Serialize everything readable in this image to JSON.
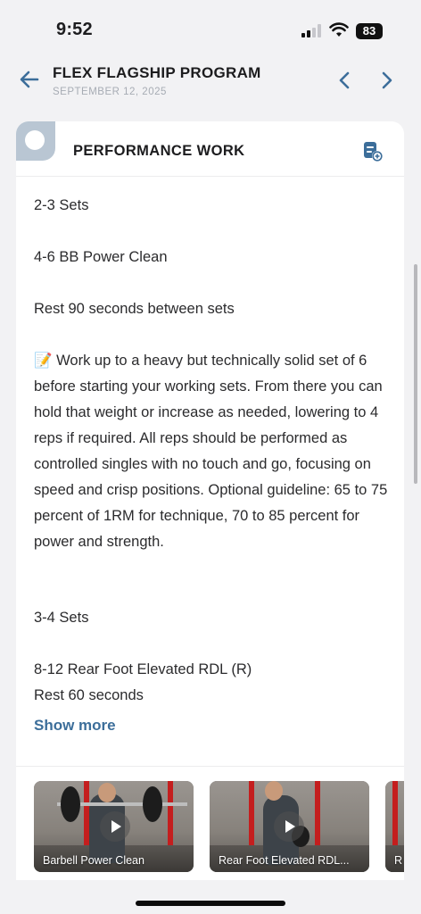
{
  "status_bar": {
    "time": "9:52",
    "battery": "83",
    "icons": [
      "cellular-signal-icon",
      "wifi-icon",
      "battery-icon"
    ]
  },
  "header": {
    "title": "FLEX FLAGSHIP PROGRAM",
    "date": "SEPTEMBER 12, 2025",
    "icons": [
      "back-arrow-icon",
      "chevron-left-icon",
      "chevron-right-icon"
    ]
  },
  "section": {
    "title": "PERFORMANCE WORK",
    "icons": [
      "section-badge-icon",
      "log-add-icon"
    ],
    "lines": [
      "2-3 Sets",
      "4-6 BB Power Clean",
      "Rest 90 seconds between sets",
      "📝 Work up to a heavy but technically solid set of 6 before starting your working sets. From there you can hold that weight or increase as needed, lowering to 4 reps if required. All reps should be performed as controlled singles with no touch and go, focusing on speed and crisp positions. Optional guideline: 65 to 75 percent of 1RM for technique, 70 to 85 percent for power and strength.",
      "3-4 Sets",
      "8-12 Rear Foot Elevated RDL (R)",
      "Rest 60 seconds"
    ],
    "show_more": "Show more"
  },
  "videos": [
    {
      "label": "Barbell Power Clean"
    },
    {
      "label": "Rear Foot Elevated RDL..."
    },
    {
      "label": "R"
    }
  ],
  "colors": {
    "accent": "#3c6e9a",
    "badge": "#b9c6d3",
    "date_text": "#a7acb4",
    "background": "#f2f2f4"
  }
}
